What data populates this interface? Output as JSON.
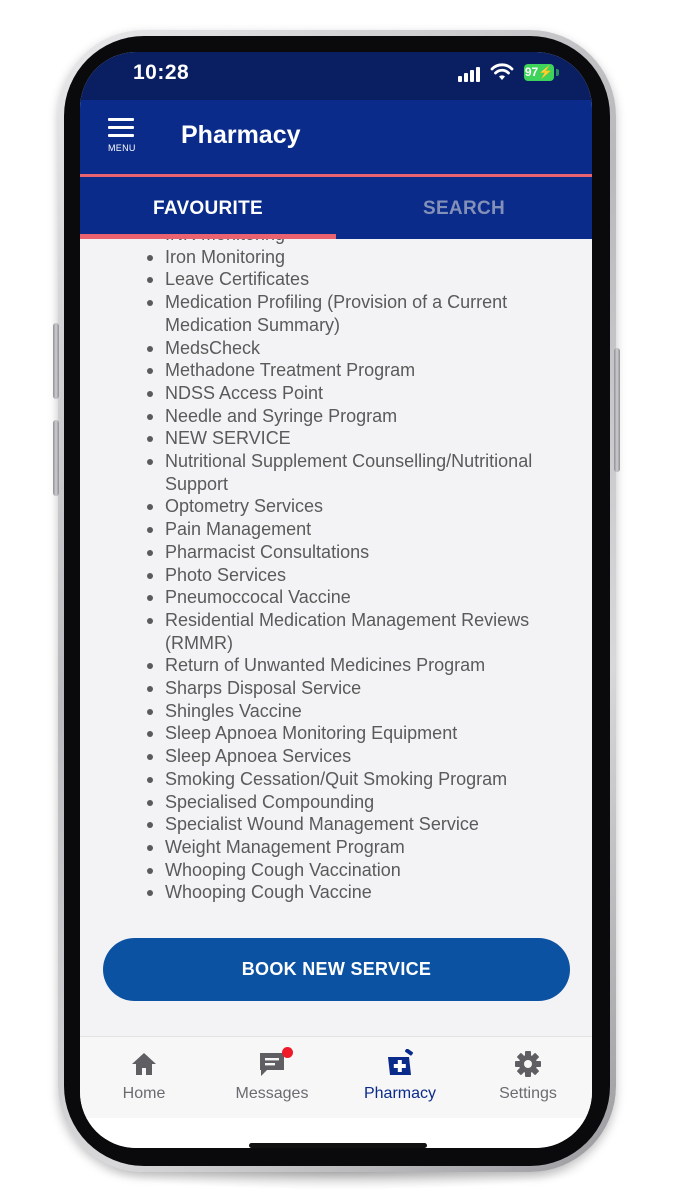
{
  "status_bar": {
    "time": "10:28",
    "battery": "97"
  },
  "header": {
    "menu_label": "MENU",
    "title": "Pharmacy"
  },
  "tabs": [
    {
      "label": "FAVOURITE",
      "active": true
    },
    {
      "label": "SEARCH",
      "active": false
    }
  ],
  "services": [
    "INR Monitoring",
    "Iron Monitoring",
    "Leave Certificates",
    "Medication Profiling (Provision of a Current Medication Summary)",
    "MedsCheck",
    "Methadone Treatment Program",
    "NDSS Access Point",
    "Needle and Syringe Program",
    "NEW SERVICE",
    "Nutritional Supplement Counselling/Nutritional Support",
    "Optometry Services",
    "Pain Management",
    "Pharmacist Consultations",
    "Photo Services",
    "Pneumoccocal Vaccine",
    "Residential Medication Management Reviews (RMMR)",
    "Return of Unwanted Medicines Program",
    "Sharps Disposal Service",
    "Shingles Vaccine",
    "Sleep Apnoea Monitoring Equipment",
    "Sleep Apnoea Services",
    "Smoking Cessation/Quit Smoking Program",
    "Specialised Compounding",
    "Specialist Wound Management Service",
    "Weight Management Program",
    "Whooping Cough Vaccination",
    "Whooping Cough Vaccine"
  ],
  "book_button": {
    "label": "BOOK NEW SERVICE"
  },
  "bottom_nav": [
    {
      "label": "Home",
      "icon": "home-icon"
    },
    {
      "label": "Messages",
      "icon": "messages-icon",
      "has_badge": true
    },
    {
      "label": "Pharmacy",
      "icon": "pharmacy-icon",
      "active": true
    },
    {
      "label": "Settings",
      "icon": "gear-icon"
    }
  ],
  "colors": {
    "header_bg": "#0a2b8a",
    "status_bg": "#0a1f62",
    "tab_indicator": "#e8636f",
    "button_bg": "#0b52a3",
    "badge": "#ef1b2a",
    "active_nav": "#0a2b8a"
  }
}
